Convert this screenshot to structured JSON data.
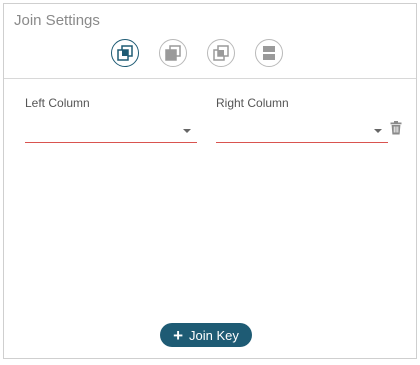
{
  "panel": {
    "title": "Join Settings"
  },
  "join_types": [
    {
      "icon": "inner-join-icon",
      "active": true
    },
    {
      "icon": "left-join-icon",
      "active": false
    },
    {
      "icon": "right-join-icon",
      "active": false
    },
    {
      "icon": "outer-join-icon",
      "active": false
    }
  ],
  "columns": {
    "left_label": "Left Column",
    "right_label": "Right Column",
    "left_value": "",
    "right_value": ""
  },
  "actions": {
    "join_key_label": "Join Key"
  },
  "colors": {
    "accent": "#1e5b74",
    "error_underline": "#d9534f"
  }
}
